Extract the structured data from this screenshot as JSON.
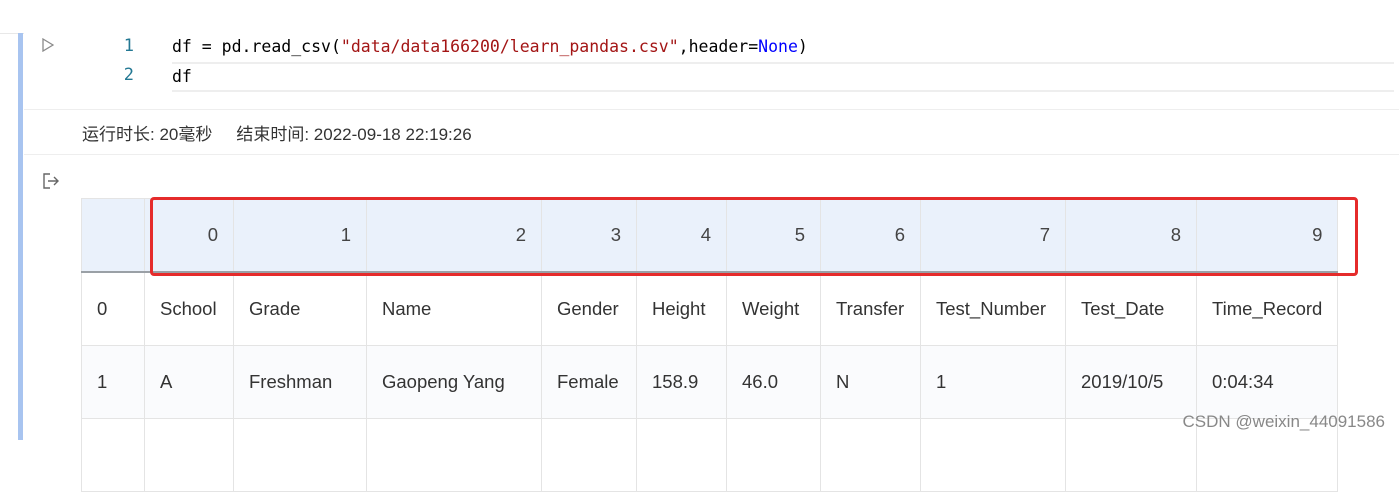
{
  "code": {
    "line_numbers": [
      "1",
      "2"
    ],
    "line1": {
      "part_a": "df = pd.read_csv(",
      "string": "\"data/data166200/learn_pandas.csv\"",
      "part_b": ",header=",
      "keyword": "None",
      "part_c": ")"
    },
    "line2": "df"
  },
  "exec_info": {
    "duration": "运行时长: 20毫秒",
    "end_time": "结束时间: 2022-09-18 22:19:26"
  },
  "dataframe": {
    "columns": [
      "",
      "0",
      "1",
      "2",
      "3",
      "4",
      "5",
      "6",
      "7",
      "8",
      "9"
    ],
    "rows": [
      [
        "0",
        "School",
        "Grade",
        "Name",
        "Gender",
        "Height",
        "Weight",
        "Transfer",
        "Test_Number",
        "Test_Date",
        "Time_Record"
      ],
      [
        "1",
        "A",
        "Freshman",
        "Gaopeng Yang",
        "Female",
        "158.9",
        "46.0",
        "N",
        "1",
        "2019/10/5",
        "0:04:34"
      ],
      [
        "",
        "",
        "",
        "",
        "",
        "",
        "",
        "",
        "",
        "",
        ""
      ]
    ]
  },
  "watermark": "CSDN @weixin_44091586",
  "colors": {
    "highlight_box": "#e52b2b",
    "cell_bar": "#a8c4f0",
    "header_bg": "#eaf1fb"
  },
  "icons": {
    "run": "play-triangle-icon",
    "output": "output-arrow-icon"
  }
}
